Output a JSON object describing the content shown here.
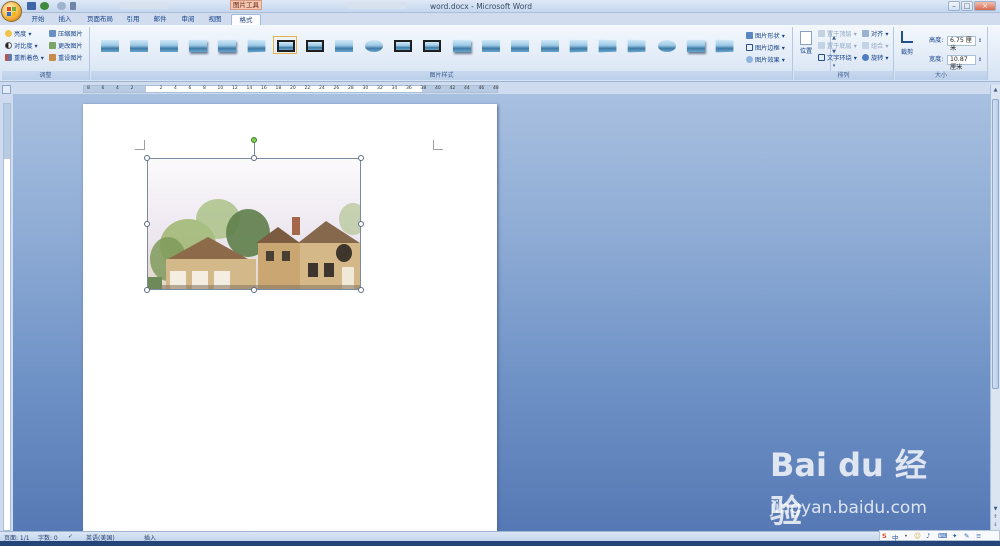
{
  "window": {
    "title": "word.docx - Microsoft Word",
    "context_tab_group": "图片工具",
    "controls": [
      "–",
      "□",
      "×"
    ]
  },
  "tabs": [
    {
      "label": "开始",
      "active": false
    },
    {
      "label": "插入",
      "active": false
    },
    {
      "label": "页面布局",
      "active": false
    },
    {
      "label": "引用",
      "active": false
    },
    {
      "label": "邮件",
      "active": false
    },
    {
      "label": "审阅",
      "active": false
    },
    {
      "label": "视图",
      "active": false
    },
    {
      "label": "格式",
      "active": true
    }
  ],
  "ribbon": {
    "adjust": {
      "label": "调整",
      "commands": [
        "亮度",
        "对比度",
        "重新着色",
        "压缩图片",
        "更改图片",
        "重设图片"
      ]
    },
    "styles": {
      "label": "图片样式",
      "thumbnail_count": 22,
      "side_commands": [
        "图片形状",
        "图片边框",
        "图片效果"
      ]
    },
    "arrange": {
      "label": "排列",
      "position_label": "位置",
      "commands": [
        "置于顶层",
        "置于底层",
        "文字环绕",
        "对齐",
        "组合",
        "旋转"
      ]
    },
    "size": {
      "label": "大小",
      "crop_label": "裁剪",
      "height_label": "高度:",
      "height_value": "6.75 厘米",
      "width_label": "宽度:",
      "width_value": "10.87 厘米"
    }
  },
  "ruler": {
    "ticks": [
      "8",
      "6",
      "4",
      "2",
      "",
      "2",
      "4",
      "6",
      "8",
      "10",
      "12",
      "14",
      "16",
      "18",
      "20",
      "22",
      "24",
      "26",
      "28",
      "30",
      "32",
      "34",
      "36",
      "38",
      "40",
      "42",
      "44",
      "46",
      "48"
    ]
  },
  "statusbar": {
    "page": "页面: 1/1",
    "words": "字数: 0",
    "language": "英语(美国)",
    "mode": "插入"
  },
  "ime": {
    "label": "中"
  },
  "watermark": {
    "brand": "Bai du 经验",
    "site": "jingyan.baidu.com"
  },
  "colors": {
    "ribbon_text": "#15428b",
    "workspace": "#6f92c6",
    "context_tab": "#f4c6b4"
  }
}
